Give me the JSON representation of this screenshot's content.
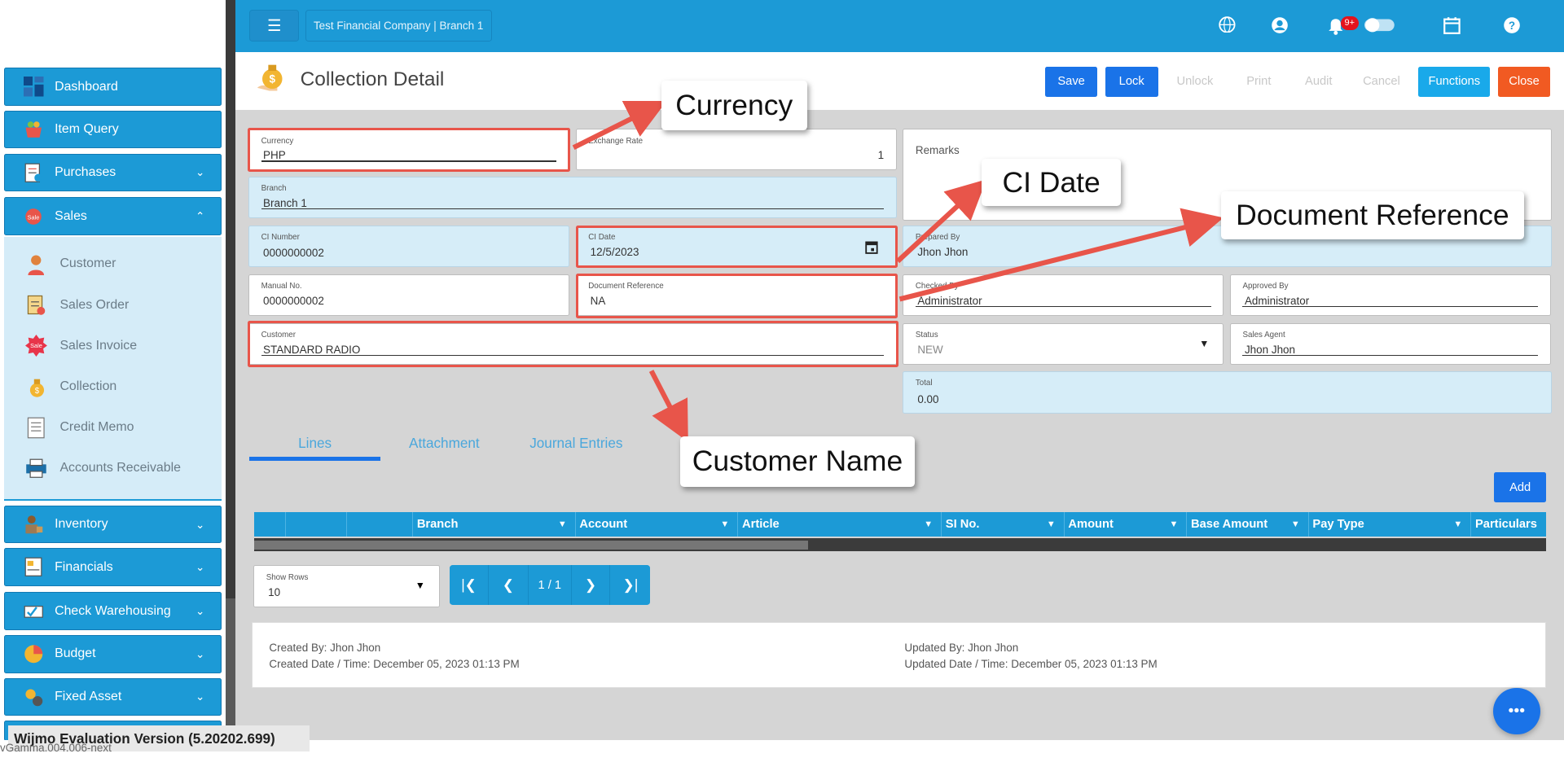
{
  "topbar": {
    "company": "Test Financial Company | Branch 1",
    "notif_badge": "9+"
  },
  "sidebar": {
    "items": [
      {
        "label": "Dashboard"
      },
      {
        "label": "Item Query"
      },
      {
        "label": "Purchases"
      },
      {
        "label": "Sales"
      },
      {
        "label": "Inventory"
      },
      {
        "label": "Financials"
      },
      {
        "label": "Check Warehousing"
      },
      {
        "label": "Budget"
      },
      {
        "label": "Fixed Asset"
      }
    ],
    "sales_sub": [
      {
        "label": "Customer"
      },
      {
        "label": "Sales Order"
      },
      {
        "label": "Sales Invoice"
      },
      {
        "label": "Collection"
      },
      {
        "label": "Credit Memo"
      },
      {
        "label": "Accounts Receivable"
      }
    ]
  },
  "header": {
    "title": "Collection Detail",
    "buttons": {
      "save": "Save",
      "lock": "Lock",
      "unlock": "Unlock",
      "print": "Print",
      "audit": "Audit",
      "cancel": "Cancel",
      "functions": "Functions",
      "close": "Close"
    }
  },
  "form": {
    "currency": {
      "label": "Currency",
      "value": "PHP"
    },
    "exchange_rate": {
      "label": "Exchange Rate",
      "value": "1"
    },
    "branch": {
      "label": "Branch",
      "value": "Branch 1"
    },
    "ci_number": {
      "label": "CI Number",
      "value": "0000000002"
    },
    "ci_date": {
      "label": "CI Date",
      "value": "12/5/2023"
    },
    "manual_no": {
      "label": "Manual No.",
      "value": "0000000002"
    },
    "doc_ref": {
      "label": "Document Reference",
      "value": "NA"
    },
    "customer": {
      "label": "Customer",
      "value": "STANDARD RADIO"
    },
    "remarks": {
      "label": "Remarks",
      "value": ""
    },
    "prepared_by": {
      "label": "Prepared By",
      "value": "Jhon Jhon"
    },
    "checked_by": {
      "label": "Checked By",
      "value": "Administrator"
    },
    "approved_by": {
      "label": "Approved By",
      "value": "Administrator"
    },
    "status": {
      "label": "Status",
      "value": "NEW"
    },
    "sales_agent": {
      "label": "Sales Agent",
      "value": "Jhon Jhon"
    },
    "total": {
      "label": "Total",
      "value": "0.00"
    }
  },
  "callouts": {
    "currency": "Currency",
    "ci_date": "CI Date",
    "doc_ref": "Document Reference",
    "customer": "Customer Name"
  },
  "tabs": [
    "Lines",
    "Attachment",
    "Journal Entries"
  ],
  "grid": {
    "add": "Add",
    "columns": [
      "Branch",
      "Account",
      "Article",
      "SI No.",
      "Amount",
      "Base Amount",
      "Pay Type",
      "Particulars"
    ]
  },
  "pager": {
    "show_rows_label": "Show Rows",
    "show_rows_value": "10",
    "page": "1 / 1"
  },
  "footer": {
    "created_by": "Created By: Jhon Jhon",
    "created_date": "Created Date / Time: December 05, 2023 01:13 PM",
    "updated_by": "Updated By: Jhon Jhon",
    "updated_date": "Updated Date / Time: December 05, 2023 01:13 PM"
  },
  "watermark": "Wijmo Evaluation Version (5.20202.699)",
  "version": "vGamma.004.006-next",
  "colors": {
    "primary": "#1c9ad6",
    "save": "#1a73e8",
    "close": "#f15a22",
    "highlight": "#e8554a"
  }
}
